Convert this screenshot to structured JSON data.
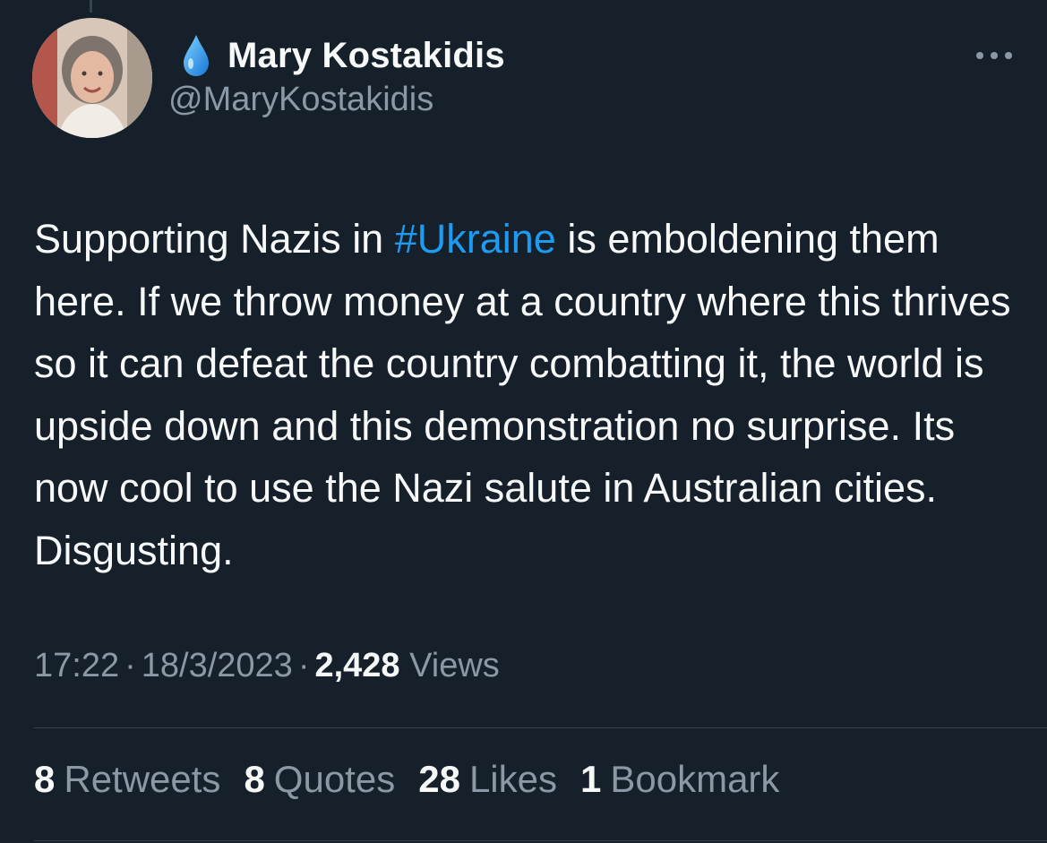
{
  "author": {
    "display_name": "Mary Kostakidis",
    "handle": "@MaryKostakidis",
    "name_emoji_icon": "water-drop-icon"
  },
  "more_icon": "more-dots-icon",
  "tweet": {
    "text_before": "Supporting Nazis in ",
    "hashtag": "#Ukraine",
    "text_after": " is emboldening them here. If we throw money at a country where this thrives so it can defeat the country combatting it, the world is upside down and this demonstration no surprise. Its now cool to use the Nazi salute in Australian cities. Disgusting."
  },
  "meta": {
    "time": "17:22",
    "separator": "·",
    "date": "18/3/2023",
    "views_count": "2,428",
    "views_label": "Views"
  },
  "stats": {
    "retweets_count": "8",
    "retweets_label": "Retweets",
    "quotes_count": "8",
    "quotes_label": "Quotes",
    "likes_count": "28",
    "likes_label": "Likes",
    "bookmarks_count": "1",
    "bookmarks_label": "Bookmark"
  },
  "colors": {
    "background": "#15202b",
    "text": "#f7f9f9",
    "secondary_text": "#8b98a5",
    "link": "#1d9bf0",
    "divider": "#38444d"
  }
}
